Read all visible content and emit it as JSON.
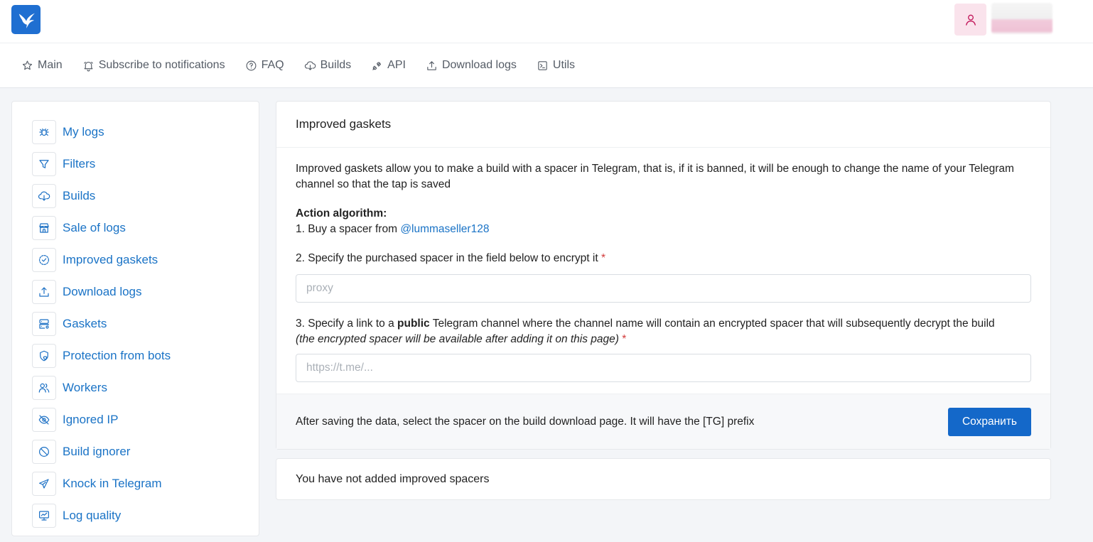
{
  "header": {
    "logo_icon": "hummingbird-logo-icon",
    "user_icon": "user-icon"
  },
  "nav": {
    "items": [
      {
        "label": "Main",
        "icon": "star-icon"
      },
      {
        "label": "Subscribe to notifications",
        "icon": "bell-icon"
      },
      {
        "label": "FAQ",
        "icon": "question-circle-icon"
      },
      {
        "label": "Builds",
        "icon": "cloud-download-icon"
      },
      {
        "label": "API",
        "icon": "plug-icon"
      },
      {
        "label": "Download logs",
        "icon": "upload-icon"
      },
      {
        "label": "Utils",
        "icon": "terminal-icon"
      }
    ]
  },
  "sidebar": {
    "items": [
      {
        "label": "My logs",
        "icon": "bug-icon"
      },
      {
        "label": "Filters",
        "icon": "filter-icon"
      },
      {
        "label": "Builds",
        "icon": "cloud-download-icon"
      },
      {
        "label": "Sale of logs",
        "icon": "store-icon"
      },
      {
        "label": "Improved gaskets",
        "icon": "badge-check-icon"
      },
      {
        "label": "Download logs",
        "icon": "upload-icon"
      },
      {
        "label": "Gaskets",
        "icon": "server-gear-icon"
      },
      {
        "label": "Protection from bots",
        "icon": "shield-star-icon"
      },
      {
        "label": "Workers",
        "icon": "users-icon"
      },
      {
        "label": "Ignored IP",
        "icon": "eye-off-icon"
      },
      {
        "label": "Build ignorer",
        "icon": "ban-icon"
      },
      {
        "label": "Knock in Telegram",
        "icon": "telegram-icon"
      },
      {
        "label": "Log quality",
        "icon": "monitor-chart-icon"
      }
    ]
  },
  "main": {
    "title": "Improved gaskets",
    "intro": "Improved gaskets allow you to make a build with a spacer in Telegram, that is, if it is banned, it will be enough to change the name of your Telegram channel so that the tap is saved",
    "algorithm_heading": "Action algorithm:",
    "step1_prefix": "1. Buy a spacer from ",
    "step1_link": "@lummaseller128",
    "step2": "2. Specify the purchased spacer in the field below to encrypt it",
    "required_mark": "*",
    "proxy_input": {
      "value": "",
      "placeholder": "proxy"
    },
    "step3_prefix": "3. Specify a link to a ",
    "step3_bold": "public",
    "step3_suffix": " Telegram channel where the channel name will contain an encrypted spacer that will subsequently decrypt the build",
    "step3_note": "(the encrypted spacer will be available after adding it on this page)",
    "channel_input": {
      "value": "",
      "placeholder": "https://t.me/..."
    },
    "footer_text": "After saving the data, select the spacer on the build download page. It will have the [TG] prefix",
    "save_label": "Сохранить"
  },
  "empty_state": {
    "text": "You have not added improved spacers"
  },
  "colors": {
    "accent": "#1468c9",
    "link": "#1a73c6",
    "required": "#d23a3a",
    "avatar_bg": "#fae3ec",
    "user_icon": "#c2185b"
  }
}
